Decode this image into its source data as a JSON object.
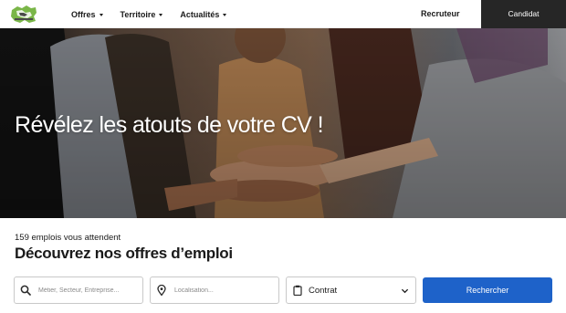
{
  "nav": {
    "items": [
      {
        "label": "Offres"
      },
      {
        "label": "Territoire"
      },
      {
        "label": "Actualités"
      }
    ],
    "recruteur": "Recruteur",
    "candidat": "Candidat"
  },
  "hero": {
    "title": "Révélez les atouts de votre CV !"
  },
  "search": {
    "count_text": "159 emplois vous attendent",
    "heading": "Découvrez nos offres d’emploi",
    "metier_placeholder": "Métier, Secteur, Entreprise...",
    "localisation_placeholder": "Localisation...",
    "contrat_label": "Contrat",
    "button_label": "Rechercher"
  },
  "icons": {
    "logo": "region-map-logo",
    "nav_caret": "caret-down-icon",
    "metier": "search-icon",
    "localisation": "map-pin-icon",
    "contrat": "clipboard-icon",
    "contrat_dropdown": "chevron-down-icon"
  },
  "colors": {
    "accent": "#1e62c9",
    "candidat_bg": "#262626",
    "logo_green": "#7ab648"
  }
}
